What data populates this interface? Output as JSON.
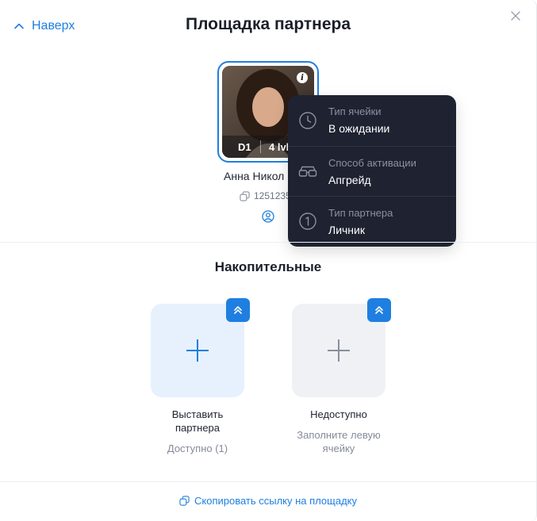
{
  "header": {
    "back_label": "Наверх",
    "title": "Площадка партнера"
  },
  "partner": {
    "name": "Анна Никол",
    "id": "1251235",
    "depth": "D1",
    "level": "4 lvl"
  },
  "tooltip": {
    "rows": [
      {
        "label": "Тип ячейки",
        "value": "В ожидании",
        "icon": "clock-icon"
      },
      {
        "label": "Способ активации",
        "value": "Апгрейд",
        "icon": "glasses-icon"
      },
      {
        "label": "Тип партнера",
        "value": "Личник",
        "icon": "number-one-icon"
      }
    ]
  },
  "section": {
    "title": "Накопительные"
  },
  "slots": [
    {
      "caption_line1": "Выставить",
      "caption_line2": "партнера",
      "sub": "Доступно (1)"
    },
    {
      "caption_line1": "Недоступно",
      "sub_line1": "Заполните левую",
      "sub_line2": "ячейку"
    }
  ],
  "footer": {
    "copy_label": "Скопировать ссылку на площадку"
  },
  "colors": {
    "accent": "#1f7fe0",
    "tooltip_bg": "#1e2231",
    "slot_active_bg": "#e6f1fd",
    "slot_disabled_bg": "#eff1f5"
  }
}
